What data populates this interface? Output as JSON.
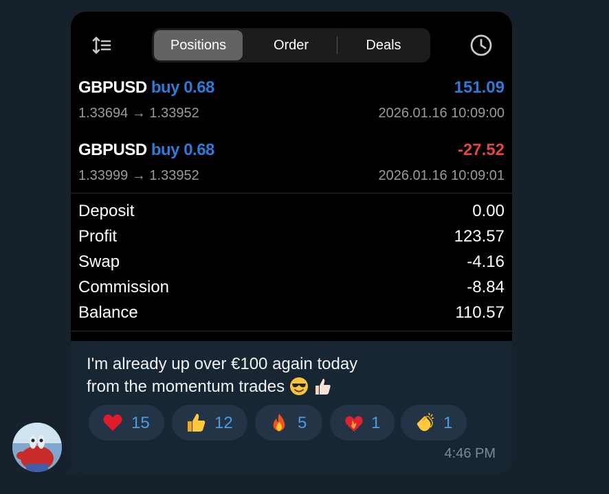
{
  "header": {
    "tabs": [
      {
        "label": "Positions",
        "active": true
      },
      {
        "label": "Order",
        "active": false
      },
      {
        "label": "Deals",
        "active": false
      }
    ],
    "sort_icon": "sort-icon",
    "history_icon": "clock-icon"
  },
  "positions": [
    {
      "symbol": "GBPUSD",
      "side": "buy 0.68",
      "open_close": "1.33694 → 1.33952",
      "profit": "151.09",
      "profit_color": "#2d7bd8",
      "time": "2026.01.16 10:09:00"
    },
    {
      "symbol": "GBPUSD",
      "side": "buy 0.68",
      "open_close": "1.33999 → 1.33952",
      "profit": "-27.52",
      "profit_color": "#e0483e",
      "time": "2026.01.16 10:09:01"
    }
  ],
  "summary": [
    {
      "label": "Deposit",
      "value": "0.00"
    },
    {
      "label": "Profit",
      "value": "123.57"
    },
    {
      "label": "Swap",
      "value": "-4.16"
    },
    {
      "label": "Commission",
      "value": "-8.84"
    },
    {
      "label": "Balance",
      "value": "110.57"
    }
  ],
  "message": {
    "line1": "I'm already up over €100 again today",
    "line2": "from the momentum trades",
    "emojis": [
      "sunglasses-face-emoji",
      "thumbs-up-emoji"
    ],
    "time": "4:46 PM"
  },
  "reactions": [
    {
      "icon": "red-heart-icon",
      "count": "15"
    },
    {
      "icon": "thumbs-up-icon",
      "count": "12"
    },
    {
      "icon": "fire-icon",
      "count": "5"
    },
    {
      "icon": "heart-on-fire-icon",
      "count": "1"
    },
    {
      "icon": "clapping-hands-icon",
      "count": "1"
    }
  ]
}
